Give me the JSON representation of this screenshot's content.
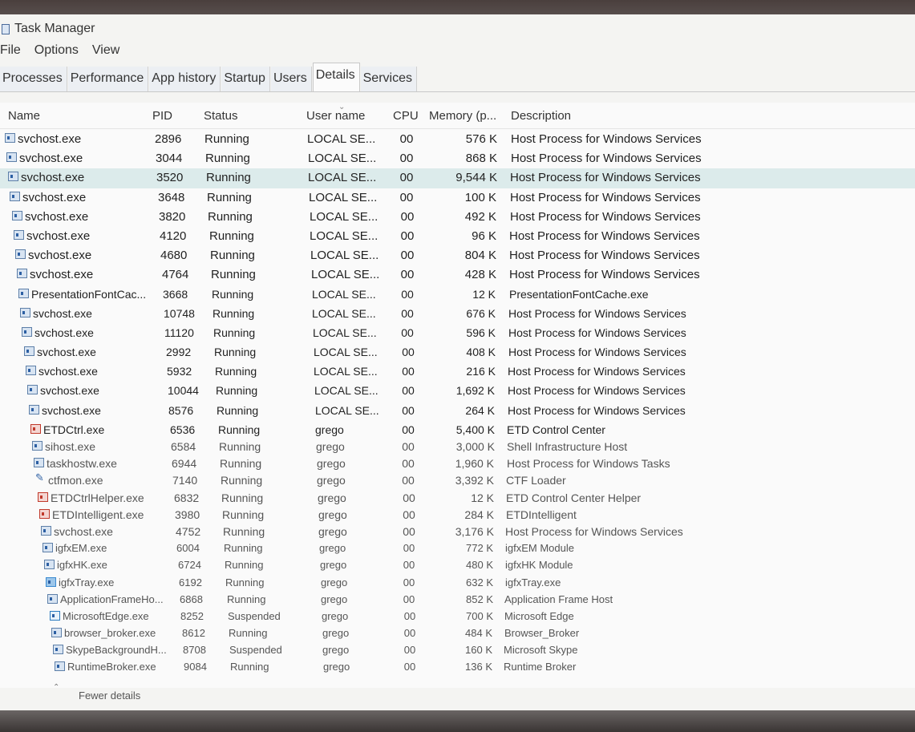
{
  "window": {
    "title": "Task Manager"
  },
  "menu": [
    "File",
    "Options",
    "View"
  ],
  "tabs": [
    "Processes",
    "Performance",
    "App history",
    "Startup",
    "Users",
    "Details",
    "Services"
  ],
  "active_tab": "Details",
  "columns": [
    "Name",
    "PID",
    "Status",
    "User name",
    "CPU",
    "Memory (p...",
    "Description"
  ],
  "selected_row_index": 2,
  "rows": [
    {
      "name": "svchost.exe",
      "pid": "2896",
      "status": "Running",
      "user": "LOCAL SE...",
      "cpu": "00",
      "mem": "576 K",
      "desc": "Host Process for Windows Services",
      "icon": "service-icon"
    },
    {
      "name": "svchost.exe",
      "pid": "3044",
      "status": "Running",
      "user": "LOCAL SE...",
      "cpu": "00",
      "mem": "868 K",
      "desc": "Host Process for Windows Services",
      "icon": "service-icon"
    },
    {
      "name": "svchost.exe",
      "pid": "3520",
      "status": "Running",
      "user": "LOCAL SE...",
      "cpu": "00",
      "mem": "9,544 K",
      "desc": "Host Process for Windows Services",
      "icon": "service-icon"
    },
    {
      "name": "svchost.exe",
      "pid": "3648",
      "status": "Running",
      "user": "LOCAL SE...",
      "cpu": "00",
      "mem": "100 K",
      "desc": "Host Process for Windows Services",
      "icon": "service-icon"
    },
    {
      "name": "svchost.exe",
      "pid": "3820",
      "status": "Running",
      "user": "LOCAL SE...",
      "cpu": "00",
      "mem": "492 K",
      "desc": "Host Process for Windows Services",
      "icon": "service-icon"
    },
    {
      "name": "svchost.exe",
      "pid": "4120",
      "status": "Running",
      "user": "LOCAL SE...",
      "cpu": "00",
      "mem": "96 K",
      "desc": "Host Process for Windows Services",
      "icon": "service-icon"
    },
    {
      "name": "svchost.exe",
      "pid": "4680",
      "status": "Running",
      "user": "LOCAL SE...",
      "cpu": "00",
      "mem": "804 K",
      "desc": "Host Process for Windows Services",
      "icon": "service-icon"
    },
    {
      "name": "svchost.exe",
      "pid": "4764",
      "status": "Running",
      "user": "LOCAL SE...",
      "cpu": "00",
      "mem": "428 K",
      "desc": "Host Process for Windows Services",
      "icon": "service-icon"
    },
    {
      "name": "PresentationFontCac...",
      "pid": "3668",
      "status": "Running",
      "user": "LOCAL SE...",
      "cpu": "00",
      "mem": "12 K",
      "desc": "PresentationFontCache.exe",
      "icon": "service-icon"
    },
    {
      "name": "svchost.exe",
      "pid": "10748",
      "status": "Running",
      "user": "LOCAL SE...",
      "cpu": "00",
      "mem": "676 K",
      "desc": "Host Process for Windows Services",
      "icon": "service-icon"
    },
    {
      "name": "svchost.exe",
      "pid": "11120",
      "status": "Running",
      "user": "LOCAL SE...",
      "cpu": "00",
      "mem": "596 K",
      "desc": "Host Process for Windows Services",
      "icon": "service-icon"
    },
    {
      "name": "svchost.exe",
      "pid": "2992",
      "status": "Running",
      "user": "LOCAL SE...",
      "cpu": "00",
      "mem": "408 K",
      "desc": "Host Process for Windows Services",
      "icon": "service-icon"
    },
    {
      "name": "svchost.exe",
      "pid": "5932",
      "status": "Running",
      "user": "LOCAL SE...",
      "cpu": "00",
      "mem": "216 K",
      "desc": "Host Process for Windows Services",
      "icon": "service-icon"
    },
    {
      "name": "svchost.exe",
      "pid": "10044",
      "status": "Running",
      "user": "LOCAL SE...",
      "cpu": "00",
      "mem": "1,692 K",
      "desc": "Host Process for Windows Services",
      "icon": "service-icon"
    },
    {
      "name": "svchost.exe",
      "pid": "8576",
      "status": "Running",
      "user": "LOCAL SE...",
      "cpu": "00",
      "mem": "264 K",
      "desc": "Host Process for Windows Services",
      "icon": "service-icon"
    },
    {
      "name": "ETDCtrl.exe",
      "pid": "6536",
      "status": "Running",
      "user": "grego",
      "cpu": "00",
      "mem": "5,400 K",
      "desc": "ETD Control Center",
      "icon": "touchpad-icon"
    },
    {
      "name": "sihost.exe",
      "pid": "6584",
      "status": "Running",
      "user": "grego",
      "cpu": "00",
      "mem": "3,000 K",
      "desc": "Shell Infrastructure Host",
      "icon": "service-icon"
    },
    {
      "name": "taskhostw.exe",
      "pid": "6944",
      "status": "Running",
      "user": "grego",
      "cpu": "00",
      "mem": "1,960 K",
      "desc": "Host Process for Windows Tasks",
      "icon": "service-icon"
    },
    {
      "name": "ctfmon.exe",
      "pid": "7140",
      "status": "Running",
      "user": "grego",
      "cpu": "00",
      "mem": "3,392 K",
      "desc": "CTF Loader",
      "icon": "pen-icon"
    },
    {
      "name": "ETDCtrlHelper.exe",
      "pid": "6832",
      "status": "Running",
      "user": "grego",
      "cpu": "00",
      "mem": "12 K",
      "desc": "ETD Control Center Helper",
      "icon": "touchpad-icon"
    },
    {
      "name": "ETDIntelligent.exe",
      "pid": "3980",
      "status": "Running",
      "user": "grego",
      "cpu": "00",
      "mem": "284 K",
      "desc": "ETDIntelligent",
      "icon": "touchpad-icon"
    },
    {
      "name": "svchost.exe",
      "pid": "4752",
      "status": "Running",
      "user": "grego",
      "cpu": "00",
      "mem": "3,176 K",
      "desc": "Host Process for Windows Services",
      "icon": "service-icon"
    },
    {
      "name": "igfxEM.exe",
      "pid": "6004",
      "status": "Running",
      "user": "grego",
      "cpu": "00",
      "mem": "772 K",
      "desc": "igfxEM Module",
      "icon": "service-icon"
    },
    {
      "name": "igfxHK.exe",
      "pid": "6724",
      "status": "Running",
      "user": "grego",
      "cpu": "00",
      "mem": "480 K",
      "desc": "igfxHK Module",
      "icon": "service-icon"
    },
    {
      "name": "igfxTray.exe",
      "pid": "6192",
      "status": "Running",
      "user": "grego",
      "cpu": "00",
      "mem": "632 K",
      "desc": "igfxTray.exe",
      "icon": "tray-icon"
    },
    {
      "name": "ApplicationFrameHo...",
      "pid": "6868",
      "status": "Running",
      "user": "grego",
      "cpu": "00",
      "mem": "852 K",
      "desc": "Application Frame Host",
      "icon": "service-icon"
    },
    {
      "name": "MicrosoftEdge.exe",
      "pid": "8252",
      "status": "Suspended",
      "user": "grego",
      "cpu": "00",
      "mem": "700 K",
      "desc": "Microsoft Edge",
      "icon": "edge-icon"
    },
    {
      "name": "browser_broker.exe",
      "pid": "8612",
      "status": "Running",
      "user": "grego",
      "cpu": "00",
      "mem": "484 K",
      "desc": "Browser_Broker",
      "icon": "service-icon"
    },
    {
      "name": "SkypeBackgroundH...",
      "pid": "8708",
      "status": "Suspended",
      "user": "grego",
      "cpu": "00",
      "mem": "160 K",
      "desc": "Microsoft Skype",
      "icon": "service-icon"
    },
    {
      "name": "RuntimeBroker.exe",
      "pid": "9084",
      "status": "Running",
      "user": "grego",
      "cpu": "00",
      "mem": "136 K",
      "desc": "Runtime Broker",
      "icon": "service-icon"
    }
  ],
  "footer": {
    "fewer_details": "Fewer details"
  }
}
